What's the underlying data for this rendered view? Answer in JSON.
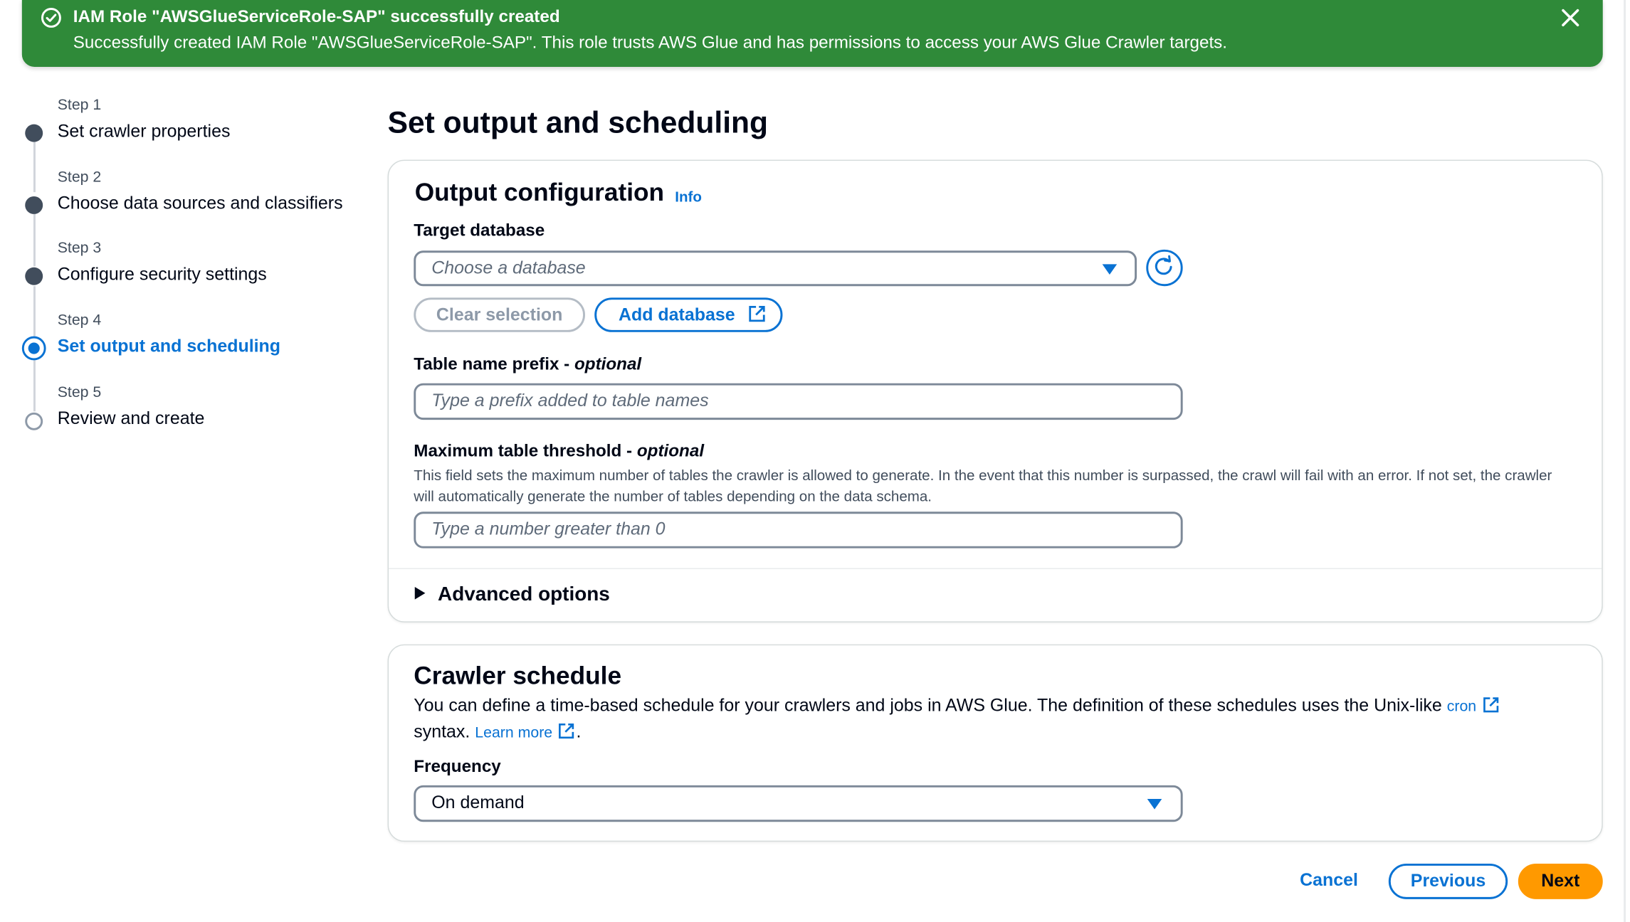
{
  "flash": {
    "title": "IAM Role \"AWSGlueServiceRole-SAP\" successfully created",
    "message": "Successfully created IAM Role \"AWSGlueServiceRole-SAP\". This role trusts AWS Glue and has permissions to access your AWS Glue Crawler targets.",
    "icon": "check-circle-icon",
    "dismiss_icon": "close-icon",
    "color": "#2f8a39"
  },
  "steps": [
    {
      "small": "Step 1",
      "title": "Set crawler properties",
      "state": "done"
    },
    {
      "small": "Step 2",
      "title": "Choose data sources and classifiers",
      "state": "done"
    },
    {
      "small": "Step 3",
      "title": "Configure security settings",
      "state": "done"
    },
    {
      "small": "Step 4",
      "title": "Set output and scheduling",
      "state": "current"
    },
    {
      "small": "Step 5",
      "title": "Review and create",
      "state": "todo"
    }
  ],
  "page_title": "Set output and scheduling",
  "output": {
    "heading": "Output configuration",
    "info": "Info",
    "target_db_label": "Target database",
    "target_db_placeholder": "Choose a database",
    "clear_selection": "Clear selection",
    "add_database": "Add database",
    "prefix_label": "Table name prefix - ",
    "prefix_optional": "optional",
    "prefix_placeholder": "Type a prefix added to table names",
    "threshold_label": "Maximum table threshold - ",
    "threshold_optional": "optional",
    "threshold_desc": "This field sets the maximum number of tables the crawler is allowed to generate. In the event that this number is surpassed, the crawl will fail with an error. If not set, the crawler will automatically generate the number of tables depending on the data schema.",
    "threshold_placeholder": "Type a number greater than 0",
    "advanced": "Advanced options"
  },
  "schedule": {
    "heading": "Crawler schedule",
    "desc_1": "You can define a time-based schedule for your crawlers and jobs in AWS Glue. The definition of these schedules uses the Unix-like",
    "cron_link": "cron",
    "desc_2": "syntax.",
    "learn_more": "Learn more",
    "desc_end": ".",
    "frequency_label": "Frequency",
    "frequency_value": "On demand"
  },
  "footer": {
    "cancel": "Cancel",
    "previous": "Previous",
    "next": "Next"
  },
  "colors": {
    "accent": "#0972d3",
    "primary_button": "#ff9900",
    "success": "#2f8a39"
  }
}
